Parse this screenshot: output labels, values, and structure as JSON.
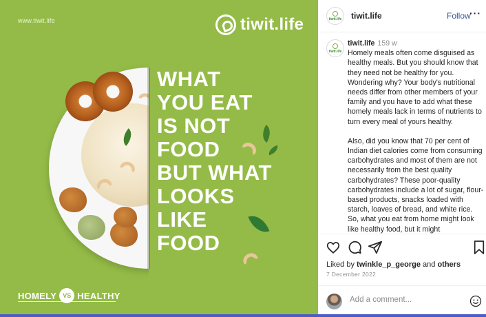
{
  "image": {
    "site_url": "www.tiwit.life",
    "brand_name": "tiwit.life",
    "headline_lines": [
      "WHAT",
      "YOU EAT",
      "IS NOT",
      "FOOD",
      "BUT WHAT",
      "LOOKS",
      "LIKE",
      "FOOD"
    ],
    "tagline_left": "HOMELY",
    "tagline_vs": "VS",
    "tagline_right": "HEALTHY",
    "background_color": "#94bb47"
  },
  "header": {
    "username": "tiwit.life",
    "follow_label": "Follow",
    "more_label": "···"
  },
  "caption": {
    "username": "tiwit.life",
    "time": "159 w",
    "paragraph1": "Homely meals often come disguised as healthy meals. But you should know that they need not be healthy for you. Wondering why? Your body's nutritional needs differ from other members of your family and you have to add what these homely meals lack in terms of nutrients to turn every meal of yours healthy.",
    "paragraph2": "Also, did you know that 70 per cent of Indian diet calories come from consuming carbohydrates and most of them are not necessarily from the best quality carbohydrates? These poor-quality carbohydrates include a lot of sugar, flour-based products, snacks loaded with starch, loaves of bread, and white rice. So, what you eat from home might look like healthy food, but it might"
  },
  "actions": {
    "like_icon": "heart-icon",
    "comment_icon": "comment-icon",
    "share_icon": "share-icon",
    "save_icon": "bookmark-icon"
  },
  "likes": {
    "prefix": "Liked by",
    "user": "twinkle_p_george",
    "joiner": "and",
    "others": "others"
  },
  "date": "7 December 2022",
  "comment": {
    "placeholder": "Add a comment...",
    "emoji_icon": "smiley-icon"
  },
  "colors": {
    "link": "#385898",
    "accent_bar": "#4a5dc7"
  }
}
